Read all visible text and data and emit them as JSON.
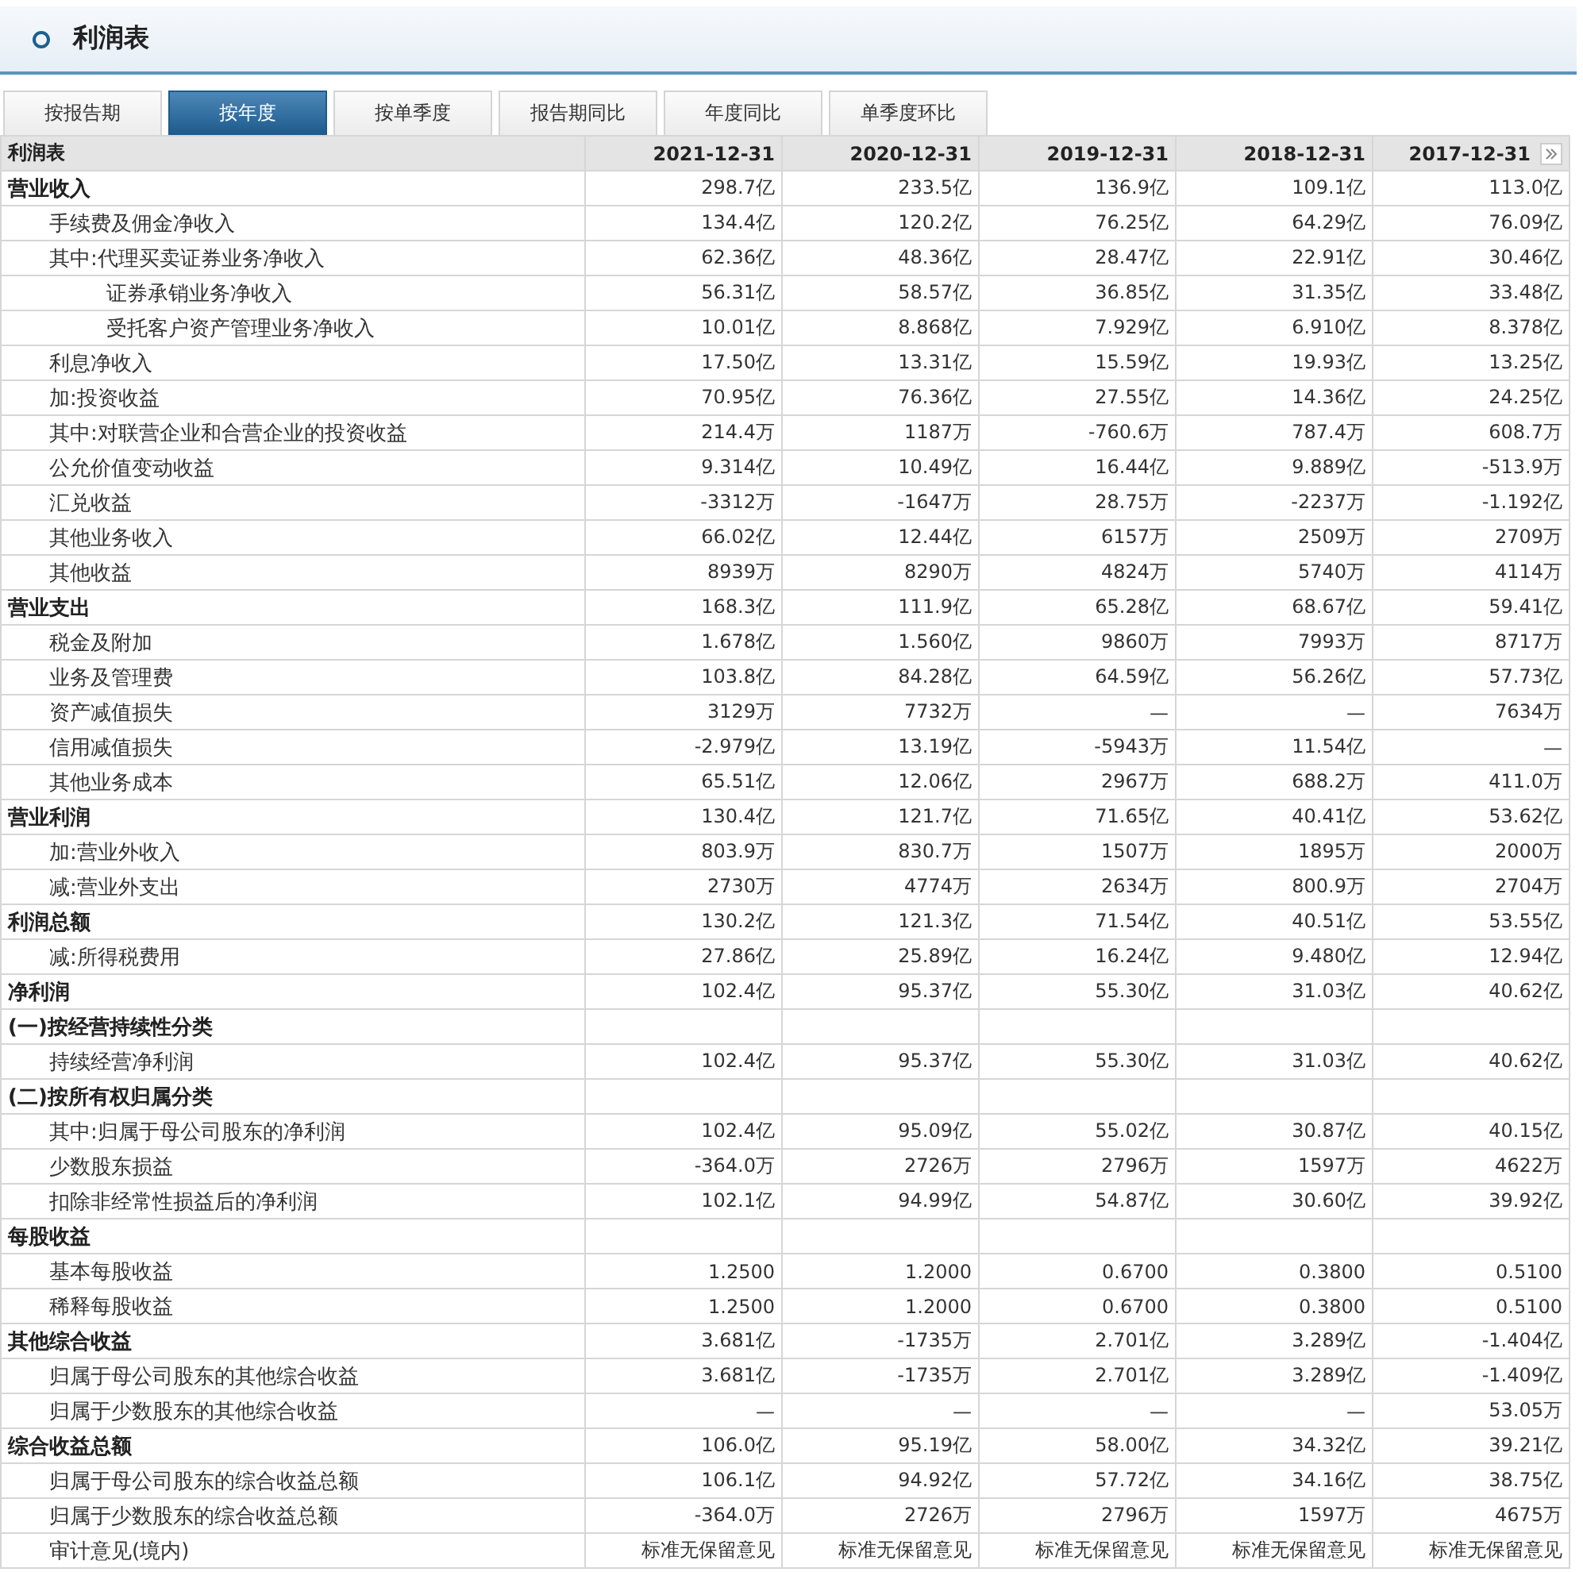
{
  "panel": {
    "title": "利润表"
  },
  "tabs": [
    {
      "label": "按报告期",
      "selected": false
    },
    {
      "label": "按年度",
      "selected": true
    },
    {
      "label": "按单季度",
      "selected": false
    },
    {
      "label": "报告期同比",
      "selected": false
    },
    {
      "label": "年度同比",
      "selected": false
    },
    {
      "label": "单季度环比",
      "selected": false
    }
  ],
  "table": {
    "columns": [
      "利润表",
      "2021-12-31",
      "2020-12-31",
      "2019-12-31",
      "2018-12-31",
      "2017-12-31"
    ],
    "rows": [
      {
        "label": "营业收入",
        "kind": "group",
        "values": [
          "298.7亿",
          "233.5亿",
          "136.9亿",
          "109.1亿",
          "113.0亿"
        ],
        "children": [
          {
            "label": "手续费及佣金净收入",
            "kind": "line",
            "values": [
              "134.4亿",
              "120.2亿",
              "76.25亿",
              "64.29亿",
              "76.09亿"
            ]
          },
          {
            "label": "其中:代理买卖证券业务净收入",
            "kind": "line",
            "values": [
              "62.36亿",
              "48.36亿",
              "28.47亿",
              "22.91亿",
              "30.46亿"
            ],
            "children": [
              {
                "label": "证券承销业务净收入",
                "kind": "line",
                "values": [
                  "56.31亿",
                  "58.57亿",
                  "36.85亿",
                  "31.35亿",
                  "33.48亿"
                ]
              },
              {
                "label": "受托客户资产管理业务净收入",
                "kind": "line",
                "values": [
                  "10.01亿",
                  "8.868亿",
                  "7.929亿",
                  "6.910亿",
                  "8.378亿"
                ]
              }
            ]
          },
          {
            "label": "利息净收入",
            "kind": "line",
            "values": [
              "17.50亿",
              "13.31亿",
              "15.59亿",
              "19.93亿",
              "13.25亿"
            ]
          },
          {
            "label": "加:投资收益",
            "kind": "line",
            "values": [
              "70.95亿",
              "76.36亿",
              "27.55亿",
              "14.36亿",
              "24.25亿"
            ]
          },
          {
            "label": "其中:对联营企业和合营企业的投资收益",
            "kind": "line",
            "values": [
              "214.4万",
              "1187万",
              "-760.6万",
              "787.4万",
              "608.7万"
            ]
          },
          {
            "label": "公允价值变动收益",
            "kind": "line",
            "values": [
              "9.314亿",
              "10.49亿",
              "16.44亿",
              "9.889亿",
              "-513.9万"
            ]
          },
          {
            "label": "汇兑收益",
            "kind": "line",
            "values": [
              "-3312万",
              "-1647万",
              "28.75万",
              "-2237万",
              "-1.192亿"
            ]
          },
          {
            "label": "其他业务收入",
            "kind": "line",
            "values": [
              "66.02亿",
              "12.44亿",
              "6157万",
              "2509万",
              "2709万"
            ]
          },
          {
            "label": "其他收益",
            "kind": "line",
            "values": [
              "8939万",
              "8290万",
              "4824万",
              "5740万",
              "4114万"
            ]
          }
        ]
      },
      {
        "label": "营业支出",
        "kind": "group",
        "values": [
          "168.3亿",
          "111.9亿",
          "65.28亿",
          "68.67亿",
          "59.41亿"
        ],
        "children": [
          {
            "label": "税金及附加",
            "kind": "line",
            "values": [
              "1.678亿",
              "1.560亿",
              "9860万",
              "7993万",
              "8717万"
            ]
          },
          {
            "label": "业务及管理费",
            "kind": "line",
            "values": [
              "103.8亿",
              "84.28亿",
              "64.59亿",
              "56.26亿",
              "57.73亿"
            ]
          },
          {
            "label": "资产减值损失",
            "kind": "line",
            "values": [
              "3129万",
              "7732万",
              "—",
              "—",
              "7634万"
            ]
          },
          {
            "label": "信用减值损失",
            "kind": "line",
            "values": [
              "-2.979亿",
              "13.19亿",
              "-5943万",
              "11.54亿",
              "—"
            ]
          },
          {
            "label": "其他业务成本",
            "kind": "line",
            "values": [
              "65.51亿",
              "12.06亿",
              "2967万",
              "688.2万",
              "411.0万"
            ]
          }
        ]
      },
      {
        "label": "营业利润",
        "kind": "group",
        "values": [
          "130.4亿",
          "121.7亿",
          "71.65亿",
          "40.41亿",
          "53.62亿"
        ],
        "children": [
          {
            "label": "加:营业外收入",
            "kind": "line",
            "values": [
              "803.9万",
              "830.7万",
              "1507万",
              "1895万",
              "2000万"
            ]
          },
          {
            "label": "减:营业外支出",
            "kind": "line",
            "values": [
              "2730万",
              "4774万",
              "2634万",
              "800.9万",
              "2704万"
            ]
          }
        ]
      },
      {
        "label": "利润总额",
        "kind": "group",
        "values": [
          "130.2亿",
          "121.3亿",
          "71.54亿",
          "40.51亿",
          "53.55亿"
        ],
        "children": [
          {
            "label": "减:所得税费用",
            "kind": "line",
            "values": [
              "27.86亿",
              "25.89亿",
              "16.24亿",
              "9.480亿",
              "12.94亿"
            ]
          }
        ]
      },
      {
        "label": "净利润",
        "kind": "group",
        "values": [
          "102.4亿",
          "95.37亿",
          "55.30亿",
          "31.03亿",
          "40.62亿"
        ]
      },
      {
        "label": "(一)按经营持续性分类",
        "kind": "group",
        "children": [
          {
            "label": "持续经营净利润",
            "kind": "line",
            "values": [
              "102.4亿",
              "95.37亿",
              "55.30亿",
              "31.03亿",
              "40.62亿"
            ]
          }
        ]
      },
      {
        "label": "(二)按所有权归属分类",
        "kind": "group",
        "children": [
          {
            "label": "其中:归属于母公司股东的净利润",
            "kind": "line",
            "values": [
              "102.4亿",
              "95.09亿",
              "55.02亿",
              "30.87亿",
              "40.15亿"
            ]
          },
          {
            "label": "少数股东损益",
            "kind": "line",
            "values": [
              "-364.0万",
              "2726万",
              "2796万",
              "1597万",
              "4622万"
            ]
          },
          {
            "label": "扣除非经常性损益后的净利润",
            "kind": "line",
            "values": [
              "102.1亿",
              "94.99亿",
              "54.87亿",
              "30.60亿",
              "39.92亿"
            ]
          }
        ]
      },
      {
        "label": "每股收益",
        "kind": "group",
        "children": [
          {
            "label": "基本每股收益",
            "kind": "line",
            "values": [
              "1.2500",
              "1.2000",
              "0.6700",
              "0.3800",
              "0.5100"
            ]
          },
          {
            "label": "稀释每股收益",
            "kind": "line",
            "values": [
              "1.2500",
              "1.2000",
              "0.6700",
              "0.3800",
              "0.5100"
            ]
          }
        ]
      },
      {
        "label": "其他综合收益",
        "kind": "group",
        "values": [
          "3.681亿",
          "-1735万",
          "2.701亿",
          "3.289亿",
          "-1.404亿"
        ],
        "children": [
          {
            "label": "归属于母公司股东的其他综合收益",
            "kind": "line",
            "values": [
              "3.681亿",
              "-1735万",
              "2.701亿",
              "3.289亿",
              "-1.409亿"
            ]
          },
          {
            "label": "归属于少数股东的其他综合收益",
            "kind": "line",
            "values": [
              "—",
              "—",
              "—",
              "—",
              "53.05万"
            ]
          }
        ]
      },
      {
        "label": "综合收益总额",
        "kind": "group",
        "values": [
          "106.0亿",
          "95.19亿",
          "58.00亿",
          "34.32亿",
          "39.21亿"
        ],
        "children": [
          {
            "label": "归属于母公司股东的综合收益总额",
            "kind": "line",
            "values": [
              "106.1亿",
              "94.92亿",
              "57.72亿",
              "34.16亿",
              "38.75亿"
            ]
          },
          {
            "label": "归属于少数股东的综合收益总额",
            "kind": "line",
            "values": [
              "-364.0万",
              "2726万",
              "2796万",
              "1597万",
              "4675万"
            ]
          }
        ]
      },
      {
        "label": "审计意见(境内)",
        "kind": "line",
        "values": [
          "标准无保留意见",
          "标准无保留意见",
          "标准无保留意见",
          "标准无保留意见",
          "标准无保留意见"
        ]
      }
    ]
  }
}
